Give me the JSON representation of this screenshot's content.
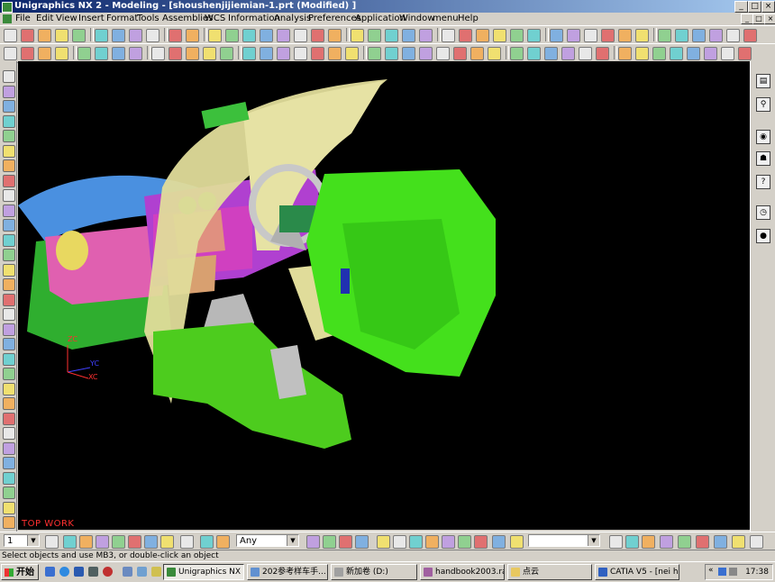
{
  "window": {
    "title": "Unigraphics NX 2 - Modeling - [shoushenjijiemian-1.prt (Modified) ]",
    "min": "_",
    "max": "□",
    "close": "×"
  },
  "menubar": {
    "items": [
      "File",
      "Edit",
      "View",
      "Insert",
      "Format",
      "Tools",
      "Assemblies",
      "WCS",
      "Information",
      "Analysis",
      "Preferences",
      "Application",
      "Window",
      "menu",
      "Help"
    ]
  },
  "viewport": {
    "background": "#000000",
    "label": "TOP WORK",
    "axes": {
      "z": "ZC",
      "y": "YC",
      "x": "XC"
    }
  },
  "bottom_toolbar": {
    "layer_value": "1",
    "filter_value": "Any"
  },
  "status_text": "Select objects and use MB3, or double-click an object",
  "taskbar": {
    "start_label": "开始",
    "tasks": [
      "Unigraphics NX 2 ...",
      "202参考样车手...",
      "新加卷 (D:)",
      "handbook2003.ra...",
      "点云",
      "CATIA V5 - [nei h..."
    ],
    "tray_text": "«",
    "clock": "17:38"
  },
  "colors": {
    "title_active": "#0a246a",
    "chrome": "#d4d0c8",
    "label_red": "#ff3030"
  }
}
